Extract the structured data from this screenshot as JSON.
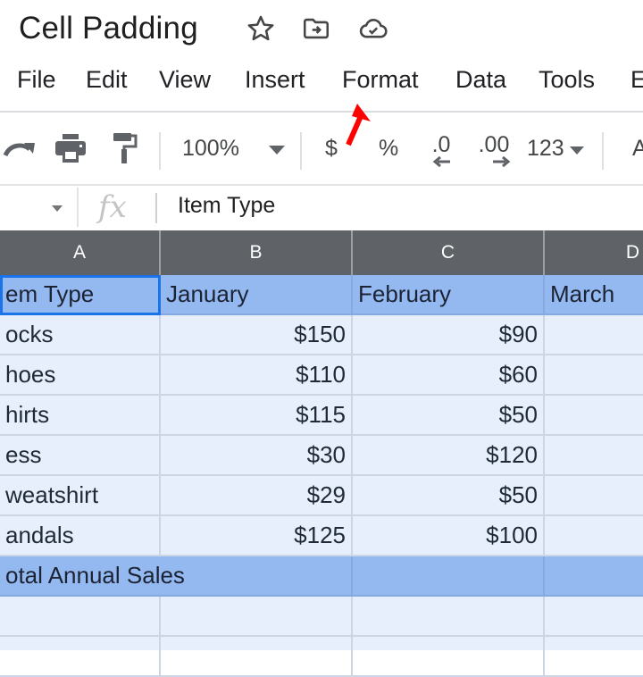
{
  "title_bar": {
    "doc_title": "Cell Padding",
    "icons": [
      "star-icon",
      "move-to-folder-icon",
      "cloud-saved-icon"
    ]
  },
  "menu": {
    "items": [
      "File",
      "Edit",
      "View",
      "Insert",
      "Format",
      "Data",
      "Tools",
      "E"
    ]
  },
  "toolbar": {
    "zoom": "100%",
    "currency": "$",
    "percent": "%",
    "decrease_decimal": ".0",
    "increase_decimal": ".00",
    "more_formats": "123",
    "font_partial": "A"
  },
  "formula_bar": {
    "fx_label": "fx",
    "value": "Item Type"
  },
  "sheet": {
    "columns": [
      "A",
      "B",
      "C",
      "D"
    ],
    "header_row": [
      "em Type",
      "January",
      "February",
      "March"
    ],
    "rows": [
      [
        "ocks",
        "$150",
        "$90",
        ""
      ],
      [
        "hoes",
        "$110",
        "$60",
        ""
      ],
      [
        "hirts",
        "$115",
        "$50",
        ""
      ],
      [
        "ess",
        "$30",
        "$120",
        ""
      ],
      [
        "weatshirt",
        "$29",
        "$50",
        ""
      ],
      [
        "andals",
        "$125",
        "$100",
        ""
      ]
    ],
    "total_row": [
      "otal Annual Sales",
      "",
      "",
      ""
    ],
    "empty_rows": 2
  },
  "colors": {
    "header_fill": "#94b8f0",
    "body_fill": "#e6effb",
    "column_header_bg": "#5f6368",
    "selection": "#1a73e8",
    "annotation_arrow": "#ff0000"
  }
}
